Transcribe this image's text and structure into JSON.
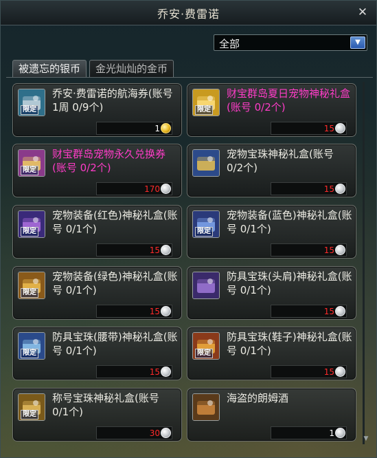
{
  "window": {
    "title": "乔安·费雷诺",
    "close_glyph": "✕"
  },
  "filter": {
    "value": "全部",
    "arrow_glyph": "▼"
  },
  "tabs": [
    {
      "label": "被遗忘的银币",
      "active": true
    },
    {
      "label": "金光灿灿的金币",
      "active": false
    }
  ],
  "limited_label": "限定",
  "items": [
    {
      "name": "乔安·费雷诺的航海券(账号1周 0/9个)",
      "name_color": "normal",
      "price": "1",
      "price_color": "white",
      "coin": "gold-coin-icon",
      "icon": "ticket-icon",
      "icon_colors": [
        "#2f6f8a",
        "#c8d8e0"
      ],
      "limited": true
    },
    {
      "name": "财宝群岛夏日宠物神秘礼盒(账号 0/2个)",
      "name_color": "pink",
      "price": "15",
      "price_color": "red",
      "coin": "silver-coin-icon",
      "icon": "gift-box-icon",
      "icon_colors": [
        "#c89a20",
        "#ffe080"
      ],
      "limited": true
    },
    {
      "name": "财宝群岛宠物永久兑换券(账号 0/2个)",
      "name_color": "pink",
      "price": "170",
      "price_color": "red",
      "coin": "silver-coin-icon",
      "icon": "coupon-icon",
      "icon_colors": [
        "#8a3a8a",
        "#f0d060"
      ],
      "limited": true
    },
    {
      "name": "宠物宝珠神秘礼盒(账号 0/2个)",
      "name_color": "normal",
      "price": "15",
      "price_color": "red",
      "coin": "silver-coin-icon",
      "icon": "orb-box-icon",
      "icon_colors": [
        "#2c4a8a",
        "#e8c050"
      ],
      "limited": false
    },
    {
      "name": "宠物装备(红色)神秘礼盒(账号 0/1个)",
      "name_color": "normal",
      "price": "15",
      "price_color": "red",
      "coin": "silver-coin-icon",
      "icon": "mystery-box-icon",
      "icon_colors": [
        "#3a2a7a",
        "#b070e0"
      ],
      "limited": true
    },
    {
      "name": "宠物装备(蓝色)神秘礼盒(账号 0/1个)",
      "name_color": "normal",
      "price": "15",
      "price_color": "red",
      "coin": "silver-coin-icon",
      "icon": "mystery-box-icon",
      "icon_colors": [
        "#2a3a7a",
        "#80a8f0"
      ],
      "limited": true
    },
    {
      "name": "宠物装备(绿色)神秘礼盒(账号 0/1个)",
      "name_color": "normal",
      "price": "15",
      "price_color": "red",
      "coin": "silver-coin-icon",
      "icon": "treasure-chest-icon",
      "icon_colors": [
        "#8a5a1a",
        "#f0c050"
      ],
      "limited": true
    },
    {
      "name": "防具宝珠(头肩)神秘礼盒(账号 0/1个)",
      "name_color": "normal",
      "price": "15",
      "price_color": "red",
      "coin": "silver-coin-icon",
      "icon": "mystery-box-icon",
      "icon_colors": [
        "#3a2a6a",
        "#a078d8"
      ],
      "limited": false
    },
    {
      "name": "防具宝珠(腰带)神秘礼盒(账号 0/1个)",
      "name_color": "normal",
      "price": "15",
      "price_color": "red",
      "coin": "silver-coin-icon",
      "icon": "gem-box-icon",
      "icon_colors": [
        "#2a4a8a",
        "#90c8f0"
      ],
      "limited": true
    },
    {
      "name": "防具宝珠(鞋子)神秘礼盒(账号 0/1个)",
      "name_color": "normal",
      "price": "15",
      "price_color": "red",
      "coin": "silver-coin-icon",
      "icon": "treasure-chest-icon",
      "icon_colors": [
        "#8a3a1a",
        "#f0b040"
      ],
      "limited": true
    },
    {
      "name": "称号宝珠神秘礼盒(账号 0/1个)",
      "name_color": "normal",
      "price": "30",
      "price_color": "red",
      "coin": "silver-coin-icon",
      "icon": "scroll-box-icon",
      "icon_colors": [
        "#7a5a1a",
        "#e8c060"
      ],
      "limited": true
    },
    {
      "name": "海盗的朗姆酒",
      "name_color": "normal",
      "price": "1",
      "price_color": "white",
      "coin": "silver-coin-icon",
      "icon": "rum-barrel-icon",
      "icon_colors": [
        "#5a3a1a",
        "#d08a40"
      ],
      "limited": false
    }
  ]
}
